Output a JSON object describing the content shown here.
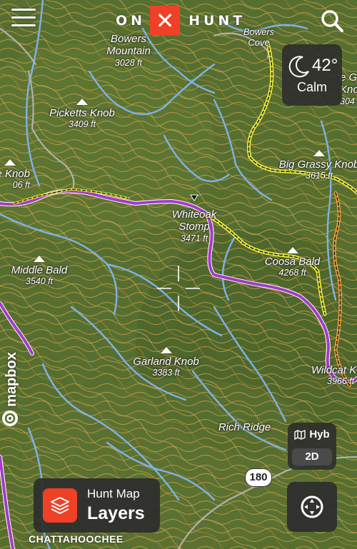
{
  "header": {
    "logo_left": "ON",
    "logo_mark": "✕",
    "logo_right": "HUNT"
  },
  "weather": {
    "temperature": "42°",
    "wind": "Calm",
    "icon": "moon-icon"
  },
  "peaks": [
    {
      "name": "Bowers Mountain",
      "name_line1": "Bowers",
      "name_line2": "Mountain",
      "elevation": "3028 ft"
    },
    {
      "name": "Picketts Knob",
      "elevation": "3409 ft"
    },
    {
      "name": "Big Grassy Knob",
      "elevation": "3615 ft"
    },
    {
      "name": "Middle Bald",
      "elevation": "3540 ft"
    },
    {
      "name": "Coosa Bald",
      "elevation": "4268 ft"
    },
    {
      "name": "Garland Knob",
      "elevation": "3383 ft"
    },
    {
      "name": "Wildcat K",
      "elevation": "3966 ft"
    },
    {
      "name": "Whiteoak Stomp",
      "name_line1": "Whiteoak",
      "name_line2": "Stomp",
      "elevation": "3471 ft"
    },
    {
      "name": "ye Knob",
      "elevation": "06 ft"
    },
    {
      "name": "e G",
      "name_line2": "Kno",
      "elevation": "304"
    }
  ],
  "places": {
    "cove_line1": "Bowers",
    "cove_line2": "Cove",
    "ridge": "Rich Ridge",
    "region": "CHATTAHOOCHEE"
  },
  "road_shield": "180",
  "attribution": "mapbox",
  "map_mode": {
    "view": "Hyb",
    "dimension": "2D"
  },
  "layers_button": {
    "line1": "Hunt Map",
    "line2": "Layers"
  },
  "colors": {
    "brand": "#ef4127",
    "panel": "#2d2d2d",
    "trail": "#a23bc8",
    "water": "#7fb2e8"
  }
}
